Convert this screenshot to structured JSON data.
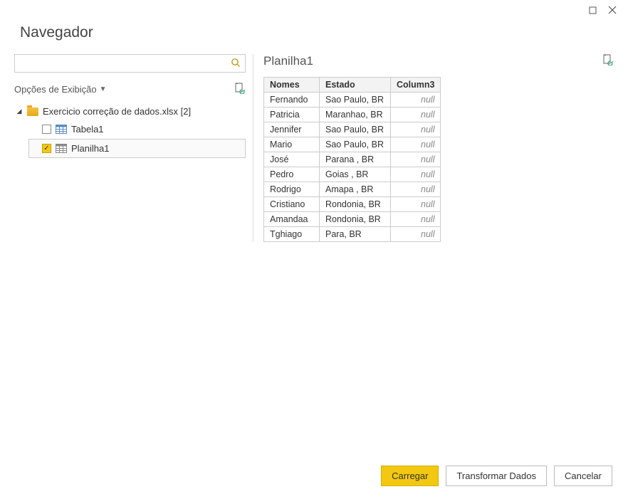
{
  "window": {
    "title": "Navegador"
  },
  "search": {
    "placeholder": ""
  },
  "displayOptions": {
    "label": "Opções de Exibição"
  },
  "tree": {
    "root": {
      "label": "Exercicio correção de dados.xlsx [2]"
    },
    "items": [
      {
        "label": "Tabela1",
        "checked": false
      },
      {
        "label": "Planilha1",
        "checked": true
      }
    ]
  },
  "preview": {
    "title": "Planilha1",
    "columns": [
      "Nomes",
      "Estado",
      "Column3"
    ],
    "rows": [
      {
        "c0": "Fernando",
        "c1": "Sao Paulo, BR",
        "c2": "null"
      },
      {
        "c0": "Patricia",
        "c1": "Maranhao, BR",
        "c2": "null"
      },
      {
        "c0": "Jennifer",
        "c1": "Sao Paulo, BR",
        "c2": "null"
      },
      {
        "c0": "Mario",
        "c1": "Sao Paulo, BR",
        "c2": "null"
      },
      {
        "c0": "José",
        "c1": "Parana , BR",
        "c2": "null"
      },
      {
        "c0": "Pedro",
        "c1": "Goias , BR",
        "c2": "null"
      },
      {
        "c0": "Rodrigo",
        "c1": "Amapa , BR",
        "c2": "null"
      },
      {
        "c0": "Cristiano",
        "c1": "Rondonia, BR",
        "c2": "null"
      },
      {
        "c0": "Amandaa",
        "c1": "Rondonia, BR",
        "c2": "null"
      },
      {
        "c0": "Tghiago",
        "c1": "Para, BR",
        "c2": "null"
      }
    ]
  },
  "footer": {
    "load": "Carregar",
    "transform": "Transformar Dados",
    "cancel": "Cancelar"
  }
}
